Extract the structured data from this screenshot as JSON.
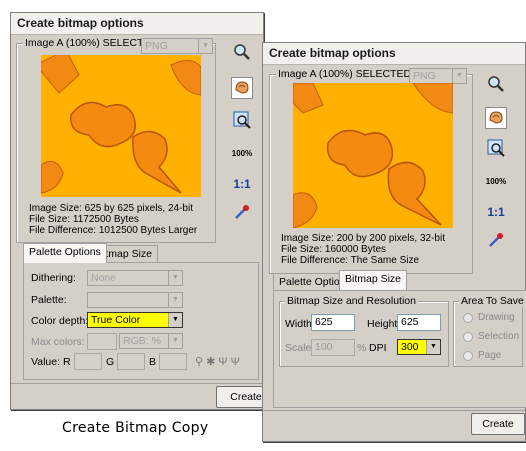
{
  "caption": "Create Bitmap Copy",
  "dialog1": {
    "title": "Create bitmap options",
    "image_label": "Image A (100%) SELECTED",
    "format": "PNG",
    "info": [
      "Image Size: 625 by 625 pixels, 24-bit",
      "File Size: 1172500 Bytes",
      "File Difference: 1012500 Bytes Larger"
    ],
    "tabs": [
      "Palette Options",
      "Bitmap Size"
    ],
    "dithering_label": "Dithering:",
    "dithering_value": "None",
    "palette_label": "Palette:",
    "palette_value": "",
    "color_depth_label": "Color depth:",
    "color_depth_value": "True Color",
    "max_colors_label": "Max colors:",
    "rgb_value": "RGB: %",
    "value_label": "Value:",
    "r_label": "R",
    "g_label": "G",
    "b_label": "B",
    "create_label": "Create"
  },
  "dialog2": {
    "title": "Create bitmap options",
    "image_label": "Image A (100%) SELECTED",
    "format": "PNG",
    "info": [
      "Image Size: 200 by 200 pixels, 32-bit",
      "File Size: 160000 Bytes",
      "File Difference: The Same Size"
    ],
    "tabs": [
      "Palette Options",
      "Bitmap Size"
    ],
    "size_group_label": "Bitmap Size and Resolution",
    "width_label": "Width",
    "width_value": "625",
    "height_label": "Height",
    "height_value": "625",
    "scale_label": "Scale",
    "scale_value": "100",
    "percent": "%",
    "dpi_label": "DPI",
    "dpi_value": "300",
    "area_group_label": "Area To Save",
    "area_options": [
      "Drawing",
      "Selection",
      "Page"
    ],
    "create_label": "Create"
  },
  "toolbar": {
    "zoom_100": "100%",
    "one_to_one": "1:1"
  },
  "colors": {
    "preview_bg": "#ffb000",
    "shape": "#f58a10",
    "highlight": "#ffff00"
  }
}
